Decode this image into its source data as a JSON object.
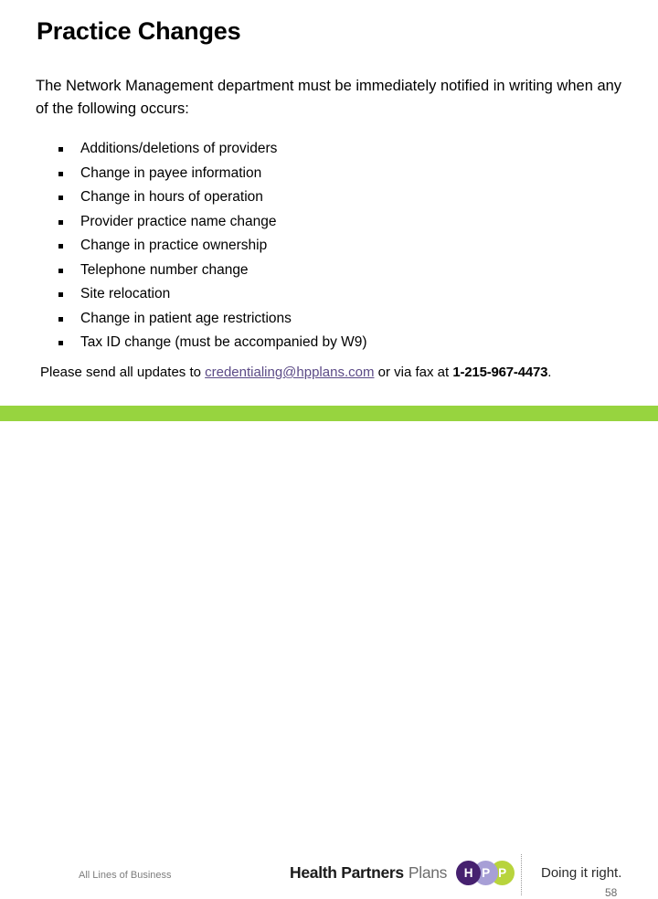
{
  "slide": {
    "title": "Practice Changes",
    "intro": "The Network Management department must be immediately notified in writing when any of the following occurs:",
    "bullets": [
      "Additions/deletions of providers",
      "Change in payee information",
      "Change in hours of operation",
      "Provider practice name change",
      "Change in practice ownership",
      "Telephone number change",
      "Site relocation",
      "Change in patient age restrictions",
      "Tax ID change (must be accompanied by W9)"
    ],
    "contact": {
      "prefix": "Please send all updates to ",
      "email": "credentialing@hpplans.com",
      "middle": " or via fax at ",
      "fax": "1-215-967-4473",
      "suffix": "."
    }
  },
  "footer": {
    "audience": "All Lines of Business",
    "brand_bold": "Health Partners",
    "brand_light": "Plans",
    "logo_letters": [
      "H",
      "P",
      "P"
    ],
    "tagline": "Doing it right.",
    "page_number": "58"
  },
  "colors": {
    "green_bar": "#97d43f",
    "logo_purple_dark": "#46216f",
    "logo_purple_light": "#a79fd6",
    "logo_lime": "#b8d43c",
    "link_purple": "#5b4a86"
  }
}
